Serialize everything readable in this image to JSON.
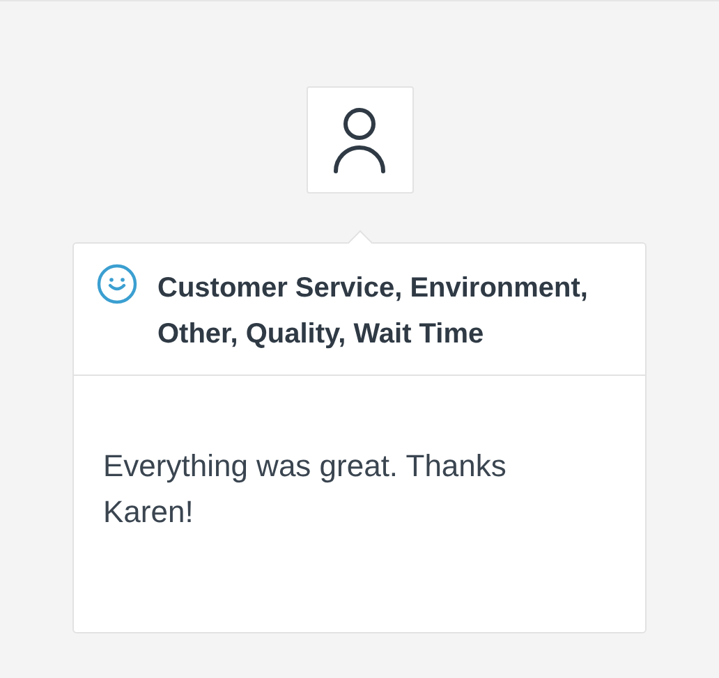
{
  "review": {
    "icon": {
      "kind": "smiley"
    },
    "categories": "Customer Service, Environment, Other, Quality, Wait Time",
    "comment": "Everything was great. Thanks Karen!"
  }
}
